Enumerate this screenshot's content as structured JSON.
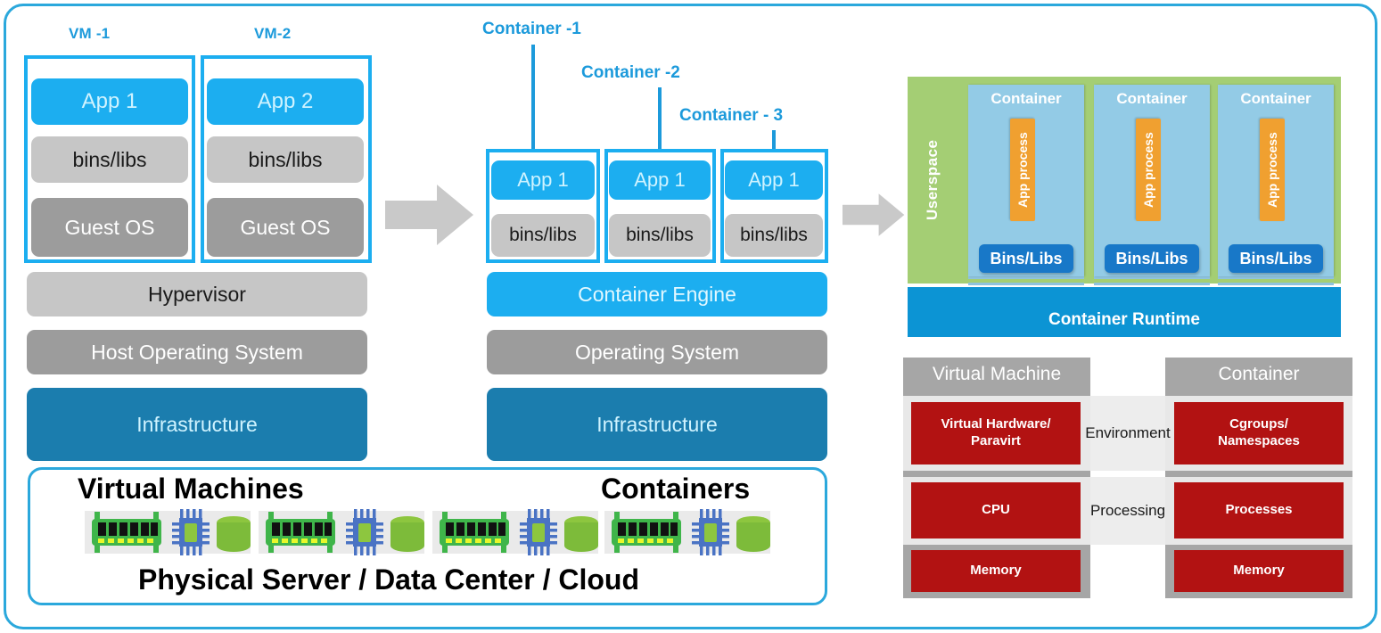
{
  "diagram": {
    "title_hidden": "Virtual Machines vs Containers architecture comparison"
  },
  "vm_column": {
    "captions": [
      "VM -1",
      "VM-2"
    ],
    "vm1_stack": [
      "App 1",
      "bins/libs",
      "Guest OS"
    ],
    "vm2_stack": [
      "App 2",
      "bins/libs",
      "Guest OS"
    ],
    "base_stack": [
      "Hypervisor",
      "Host Operating System",
      "Infrastructure"
    ]
  },
  "container_column": {
    "captions": [
      "Container -1",
      "Container -2",
      "Container - 3"
    ],
    "containers": [
      {
        "app": "App 1",
        "bins": "bins/libs"
      },
      {
        "app": "App 1",
        "bins": "bins/libs"
      },
      {
        "app": "App 1",
        "bins": "bins/libs"
      }
    ],
    "base_stack": [
      "Container Engine",
      "Operating System",
      "Infrastructure"
    ]
  },
  "physical_panel": {
    "left_label": "Virtual Machines",
    "right_label": "Containers",
    "bottom_label": "Physical Server / Data Center / Cloud",
    "hardware_icons": [
      "ram-icon",
      "cpu-icon",
      "disk-icon"
    ],
    "group_count": 4
  },
  "userspace_panel": {
    "userspace_label": "Userspace",
    "runtime_label": "Container Runtime",
    "containers": [
      {
        "title": "Container",
        "process": "App process",
        "bins": "Bins/Libs"
      },
      {
        "title": "Container",
        "process": "App process",
        "bins": "Bins/Libs"
      },
      {
        "title": "Container",
        "process": "App process",
        "bins": "Bins/Libs"
      }
    ]
  },
  "comparison_table": {
    "headers": [
      "Virtual Machine",
      "Container"
    ],
    "rows": [
      {
        "middle": "Environment",
        "left": "Virtual Hardware/\nParavirt",
        "right": "Cgroups/\nNamespaces"
      },
      {
        "middle": "Processing",
        "left": "CPU",
        "right": "Processes"
      },
      {
        "middle": "",
        "left": "Memory",
        "right": "Memory"
      }
    ]
  },
  "colors": {
    "accent_blue": "#1CAEF0",
    "frame_blue": "#2BA8DC",
    "caption_blue": "#1C9ADB",
    "infra_blue": "#1B7DAE",
    "light_gray": "#C6C6C6",
    "mid_gray": "#9C9C9C",
    "userspace_green": "#A4CE74",
    "container_blue": "#93CBE6",
    "runtime_blue": "#0C94D4",
    "orange": "#F0A030",
    "binslibs_blue": "#1878C8",
    "red": "#B21212",
    "table_gray": "#A6A6A6",
    "arrow_gray": "#C9C9C9"
  }
}
